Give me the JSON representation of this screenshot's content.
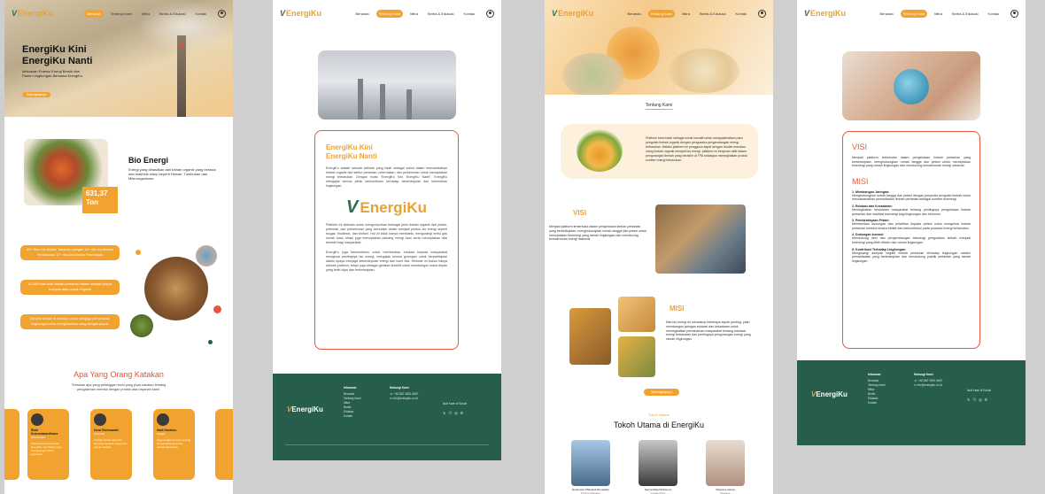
{
  "nav": {
    "brand": "EnergiKu",
    "items": [
      "Beranda",
      "Tentang Kami",
      "Mitra",
      "Berita & Edukasi",
      "Kontak"
    ]
  },
  "page1": {
    "hero": {
      "title": "EnergiKu Kini EnergiKu Nanti",
      "subtitle": "Mekarkan Potensi Energi Bersih dari Panen Lingkungan Bersama EnergiKu",
      "button": "Selengkapnya"
    },
    "bio": {
      "title": "Bio Energi",
      "description": "Energi yang dihasilkan dari bahan organik yang berasal dari makhluk hidup seperti Hewan, Tumbuhan dan Mikroorganisme.",
      "stat": "631,37 Ton"
    },
    "stats": [
      "40+ Ribu ton limbah Tanaman pangan 14+ ribu ton limbah Perkebunan 17+ ribu ton limbah Peternakan",
      "10-15% dari total limbah pertanian dalam menjadi pupuk Kompos atau pupuk Organik",
      "Dimana limbah di lakukan untuk menjaga pemanasan lingkungan serta menghasilkan uang dengan pupuk"
    ],
    "testimonials": {
      "title": "Apa Yang Orang Katakan",
      "subtitle": "Temukan apa yang pelanggan kami yang puas katakan tentang pengalaman mereka dengan produk atau layanan kami.",
      "cards": [
        {
          "name": "Rizki Kusumawardhana",
          "role": "Rizki Petani",
          "text": "Teknologi bioenergi dari EnergiKu membantu saya mengurangi limbah pertanian."
        },
        {
          "name": "Dewi Rahmawati",
          "role": "Peternak",
          "text": "Limbah ternak kami kini berguna menjadi energi dan pupuk organik."
        },
        {
          "name": "Hadi Santoso",
          "role": "Pelajar",
          "text": "Saya belajar banyak tentang energi terbarukan dari edukasi EnergiKu."
        }
      ]
    }
  },
  "page2": {
    "card": {
      "title": "EnergiKu Kini EnergiKu Nanti",
      "para1": "EnergiKu adalah sebuah website yang hadir sebagai solusi dalam memanfaatkan limbah organik dari sektor pertanian, peternakan, dan perkebunan untuk menciptakan energi terbarukan. Dengan motto \"EnergiKu Kini, EnergiKu Nanti\", EnergiKu mengajak semua pihak berkomitmen terhadap keberlanjutan dan kebersihan lingkungan.",
      "logo": "EnergiKu",
      "para2": "Platform ini didesain untuk mengumpulkan berbagai jenis limbah organik dari petani, peternak, dan perkebunan yang kemudian diolah menjadi produk bio energi seperti biogas, biodiesel, dan biofuel. Hal ini tidak hanya membantu mengurangi emisi gas rumah kaca, tetapi juga menciptakan peluang energi baru serta menciptakan nilai tambah bagi masyarakat.",
      "para3": "EnergiKu juga berkomitmen untuk memberikan edukasi kepada masyarakat mengenai pentingnya bio energi, mengajak semua golongan untuk berpartisipasi dalam upaya menjaga keberlanjutan energi dan bumi kita. Website ini bukan hanya sebuah platform, tetapi juga sebagai gerakan kolektif untuk membangun masa depan yang lebih hijau dan berkelanjutan."
    },
    "footer": {
      "brand": "EnergiKu",
      "col1_title": "Informasi",
      "col1_items": [
        "Beranda",
        "Tentang Kami",
        "Mitra",
        "Berita",
        "Edukasi",
        "Kontak"
      ],
      "col2_title": "Hubungi Kami",
      "phone": "+62 857 4551 6657",
      "email": "info@energiku.co.id",
      "follow": "Ikuti Kami di Sosial",
      "social_icons": [
        "x-icon",
        "facebook-icon",
        "instagram-icon",
        "whatsapp-icon"
      ]
    }
  },
  "page3": {
    "about_label": "Tentang Kami",
    "about_text": "Platform kami hadir sebagai solusi inovatif untuk mengoptimalkan para pengolah limbah organik dengan pengusaha pengembangan energi terbarukan. Melalui platform ini pengguna dapat dengan mudah mendaur ulang limbah organik menjadi bio energi, platform ini berperan aktif dalam pengurangan limbah yang berakhir di TPA sekaligus meningkatkan produk sumber energi terbarukan.",
    "visi_title": "VISI",
    "visi_text": "Menjadi platform terkemuka dalam pengelolaan limbah pertanian yang berkelanjutan, menghubungkan rumah tangga dan petani untuk menciptakan bioenergi yang ramah lingkungan dan mendorong kemakmuran energi nasional.",
    "misi_title": "MISI",
    "misi_text": "Misi bio energi ini mencakup beberapa aspek penting, yaitu membangun jaringan edukasi dan kesadaran untuk meningkatkan pemahaman masyarakat tentang manfaat energi terbarukan dan pentingnya pengurangan energi yang ramah lingkungan.",
    "button": "Selengkapnya",
    "leaders_small": "Tokoh Utama",
    "leaders_title": "Tokoh Utama di EnergiKu",
    "leaders": [
      {
        "name": "Emanuela Tiffanianti Romadani",
        "role": "Product Manager"
      },
      {
        "name": "Senna Raja Wicksemo",
        "role": "Frontend Dev"
      },
      {
        "name": "Mayluna Listera",
        "role": "Designer"
      }
    ]
  },
  "page4": {
    "visi_title": "VISI",
    "visi_text": "Menjadi platform terkemuka dalam pengelolaan limbah pertanian yang berkelanjutan, menghubungkan rumah tangga dan petani untuk menciptakan bioenergi yang ramah lingkungan dan mendorong kemakmuran energi nasional.",
    "misi_title": "MISI",
    "misi": [
      {
        "title": "1. Membangun Jaringan:",
        "text": "Menghubungkan rumah tangga dan petani dengan penyedia pengolah limbah untuk memaksimalkan pemanfaatan limbah pertanian sebagai sumber bioenergi."
      },
      {
        "title": "2. Edukasi dan Kesadaran:",
        "text": "Meningkatkan kesadaran masyarakat tentang pentingnya pengelolaan limbah pertanian dan manfaat bioenergi bagi lingkungan dan ekonomi."
      },
      {
        "title": "3. Pemberdayaan Petani:",
        "text": "Memberikan dukungan dan pelatihan kepada petani untuk mengelola limbah pertanian mereka secara efektif dan berkontribusi pada produksi energi terbarukan."
      },
      {
        "title": "4. Dukungan Inovasi:",
        "text": "Mendukung riset dan pengembangan teknologi pengolahan limbah menjadi bioenergi yang lebih efisien dan ramah lingkungan."
      },
      {
        "title": "5. Kontribusi Terhadap Lingkungan:",
        "text": "Mengurangi dampak negatif limbah pertanian terhadap lingkungan melalui pemanfaatan yang berkelanjutan dan mendukung praktik pertanian yang ramah lingkungan."
      }
    ]
  },
  "colors": {
    "accent": "#f2a32f",
    "brand_green": "#265e4b",
    "heading_red": "#e8553a"
  }
}
